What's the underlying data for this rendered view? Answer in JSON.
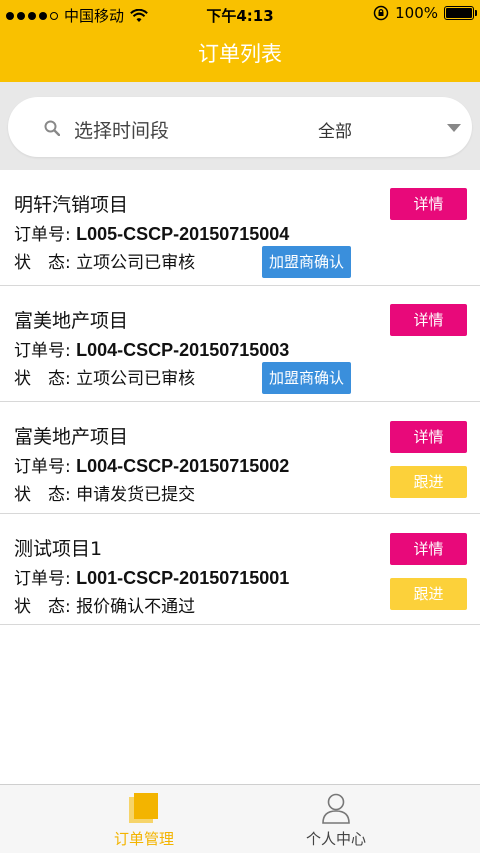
{
  "status_bar": {
    "carrier": "中国移动",
    "time": "下午4:13",
    "battery": "100%"
  },
  "nav": {
    "title": "订单列表"
  },
  "filter": {
    "placeholder": "选择时间段",
    "value": "全部"
  },
  "orders": [
    {
      "name": "明轩汽销项目",
      "order_label": "订单号:",
      "order_no": "L005-CSCP-20150715004",
      "status_label": "状　态:",
      "status": "立项公司已审核",
      "detail_label": "详情",
      "action_label": "加盟商确认",
      "action_type": "franchise"
    },
    {
      "name": "富美地产项目",
      "order_label": "订单号:",
      "order_no": "L004-CSCP-20150715003",
      "status_label": "状　态:",
      "status": "立项公司已审核",
      "detail_label": "详情",
      "action_label": "加盟商确认",
      "action_type": "franchise"
    },
    {
      "name": "富美地产项目",
      "order_label": "订单号:",
      "order_no": "L004-CSCP-20150715002",
      "status_label": "状　态:",
      "status": "申请发货已提交",
      "detail_label": "详情",
      "action_label": "跟进",
      "action_type": "follow"
    },
    {
      "name": "测试项目1",
      "order_label": "订单号:",
      "order_no": "L001-CSCP-20150715001",
      "status_label": "状　态:",
      "status": "报价确认不通过",
      "detail_label": "详情",
      "action_label": "跟进",
      "action_type": "follow"
    }
  ],
  "tabbar": {
    "tabs": [
      {
        "label": "订单管理",
        "icon": "orders-icon",
        "active": true
      },
      {
        "label": "个人中心",
        "icon": "person-icon",
        "active": false
      }
    ]
  },
  "colors": {
    "brand_yellow": "#f9c100",
    "detail_pink": "#e8097a",
    "follow_yellow": "#fcd13a",
    "franchise_blue": "#3a8fdc"
  }
}
